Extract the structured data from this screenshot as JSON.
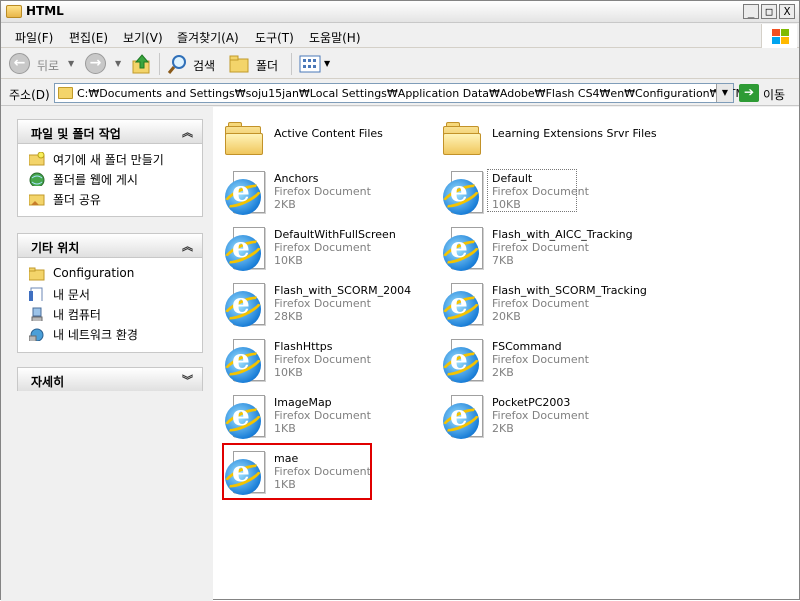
{
  "window": {
    "title": "HTML",
    "buttons": {
      "minimize": "_",
      "maximize": "□",
      "close": "X"
    }
  },
  "menu": [
    {
      "label": "파일(F)"
    },
    {
      "label": "편집(E)"
    },
    {
      "label": "보기(V)"
    },
    {
      "label": "즐겨찾기(A)"
    },
    {
      "label": "도구(T)"
    },
    {
      "label": "도움말(H)"
    }
  ],
  "toolbar": {
    "back_label": "뒤로",
    "search_label": "검색",
    "folders_label": "폴더"
  },
  "address": {
    "label": "주소(D)",
    "path": "C:₩Documents and Settings₩soju15jan₩Local Settings₩Application Data₩Adobe₩Flash CS4₩en₩Configuration₩HTML",
    "go_label": "이동"
  },
  "taskpane": {
    "tasks": {
      "title": "파일 및 폴더 작업",
      "items": [
        {
          "label": "여기에 새 폴더 만들기",
          "icon": "new-folder-icon"
        },
        {
          "label": "폴더를 웹에 게시",
          "icon": "publish-web-icon"
        },
        {
          "label": "폴더 공유",
          "icon": "share-folder-icon"
        }
      ]
    },
    "other_places": {
      "title": "기타 위치",
      "items": [
        {
          "label": "Configuration",
          "icon": "folder-icon"
        },
        {
          "label": "내 문서",
          "icon": "my-documents-icon"
        },
        {
          "label": "내 컴퓨터",
          "icon": "my-computer-icon"
        },
        {
          "label": "내 네트워크 환경",
          "icon": "network-icon"
        }
      ]
    },
    "details": {
      "title": "자세히"
    }
  },
  "files": {
    "col1": [
      {
        "name": "Active Content Files",
        "kind": "folder"
      },
      {
        "name": "Anchors",
        "type": "Firefox Document",
        "size": "2KB"
      },
      {
        "name": "DefaultWithFullScreen",
        "type": "Firefox Document",
        "size": "10KB"
      },
      {
        "name": "Flash_with_SCORM_2004",
        "type": "Firefox Document",
        "size": "28KB"
      },
      {
        "name": "FlashHttps",
        "type": "Firefox Document",
        "size": "10KB"
      },
      {
        "name": "ImageMap",
        "type": "Firefox Document",
        "size": "1KB"
      },
      {
        "name": "mae",
        "type": "Firefox Document",
        "size": "1KB"
      }
    ],
    "col2": [
      {
        "name": "Learning Extensions Srvr Files",
        "kind": "folder"
      },
      {
        "name": "Default",
        "type": "Firefox Document",
        "size": "10KB"
      },
      {
        "name": "Flash_with_AICC_Tracking",
        "type": "Firefox Document",
        "size": "7KB"
      },
      {
        "name": "Flash_with_SCORM_Tracking",
        "type": "Firefox Document",
        "size": "20KB"
      },
      {
        "name": "FSCommand",
        "type": "Firefox Document",
        "size": "2KB"
      },
      {
        "name": "PocketPC2003",
        "type": "Firefox Document",
        "size": "2KB"
      }
    ]
  }
}
